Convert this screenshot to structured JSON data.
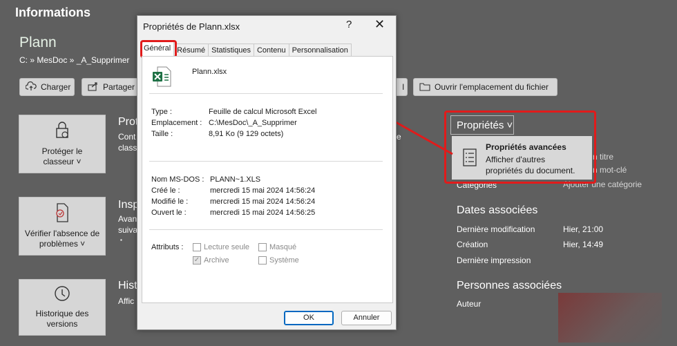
{
  "backstage": {
    "title": "Informations",
    "doc_name": "Plann",
    "path": "C: » MesDoc » _A_Supprimer",
    "buttons": {
      "upload": "Charger",
      "share": "Partager",
      "partial": "l",
      "open_location": "Ouvrir l'emplacement du fichier"
    },
    "tiles": [
      {
        "label": "Protéger le classeur ˅"
      },
      {
        "label": "Vérifier l'absence de problèmes ˅"
      },
      {
        "label": "Historique des versions"
      }
    ],
    "sections": [
      {
        "title": "Prot",
        "line1": "Cont",
        "line2": "classe",
        "tail": "e"
      },
      {
        "title": "Insp",
        "line1": "Avan",
        "line2": "suiva",
        "bullet": "▪"
      },
      {
        "title": "Hist",
        "line1": "Affic"
      }
    ],
    "properties_button": "Propriétés ˅",
    "properties_menu": {
      "title": "Propriétés avancées",
      "desc1": "Afficher d'autres",
      "desc2": "propriétés du document."
    },
    "right_partial": {
      "r1": "n titre",
      "r2": "n mot-clé",
      "cat_label": "Catégories",
      "cat_value": "Ajouter une catégorie"
    },
    "dates_title": "Dates associées",
    "dates": [
      {
        "label": "Dernière modification",
        "value": "Hier, 21:00"
      },
      {
        "label": "Création",
        "value": "Hier, 14:49"
      },
      {
        "label": "Dernière impression",
        "value": ""
      }
    ],
    "people_title": "Personnes associées",
    "author_label": "Auteur"
  },
  "dialog": {
    "title": "Propriétés de Plann.xlsx",
    "help": "?",
    "close": "✕",
    "tabs": [
      "Général",
      "Résumé",
      "Statistiques",
      "Contenu",
      "Personnalisation"
    ],
    "file_name": "Plann.xlsx",
    "info": [
      {
        "label": "Type :",
        "value": "Feuille de calcul Microsoft Excel"
      },
      {
        "label": "Emplacement :",
        "value": "C:\\MesDoc\\_A_Supprimer"
      },
      {
        "label": "Taille :",
        "value": "8,91 Ko (9 129 octets)"
      }
    ],
    "dates": [
      {
        "label": "Nom MS-DOS :",
        "value": "PLANN~1.XLS"
      },
      {
        "label": "Créé le :",
        "value": "mercredi 15 mai 2024 14:56:24"
      },
      {
        "label": "Modifié le :",
        "value": "mercredi 15 mai 2024 14:56:24"
      },
      {
        "label": "Ouvert le :",
        "value": "mercredi 15 mai 2024 14:56:25"
      }
    ],
    "attributes_label": "Attributs :",
    "attributes": [
      {
        "label": "Lecture seule",
        "checked": false
      },
      {
        "label": "Masqué",
        "checked": false
      },
      {
        "label": "Archive",
        "checked": true
      },
      {
        "label": "Système",
        "checked": false
      }
    ],
    "ok": "OK",
    "cancel": "Annuler"
  },
  "colors": {
    "annotation_red": "#e11b1b",
    "excel_green": "#1e7145",
    "backstage_bg": "#5f5f5f"
  }
}
